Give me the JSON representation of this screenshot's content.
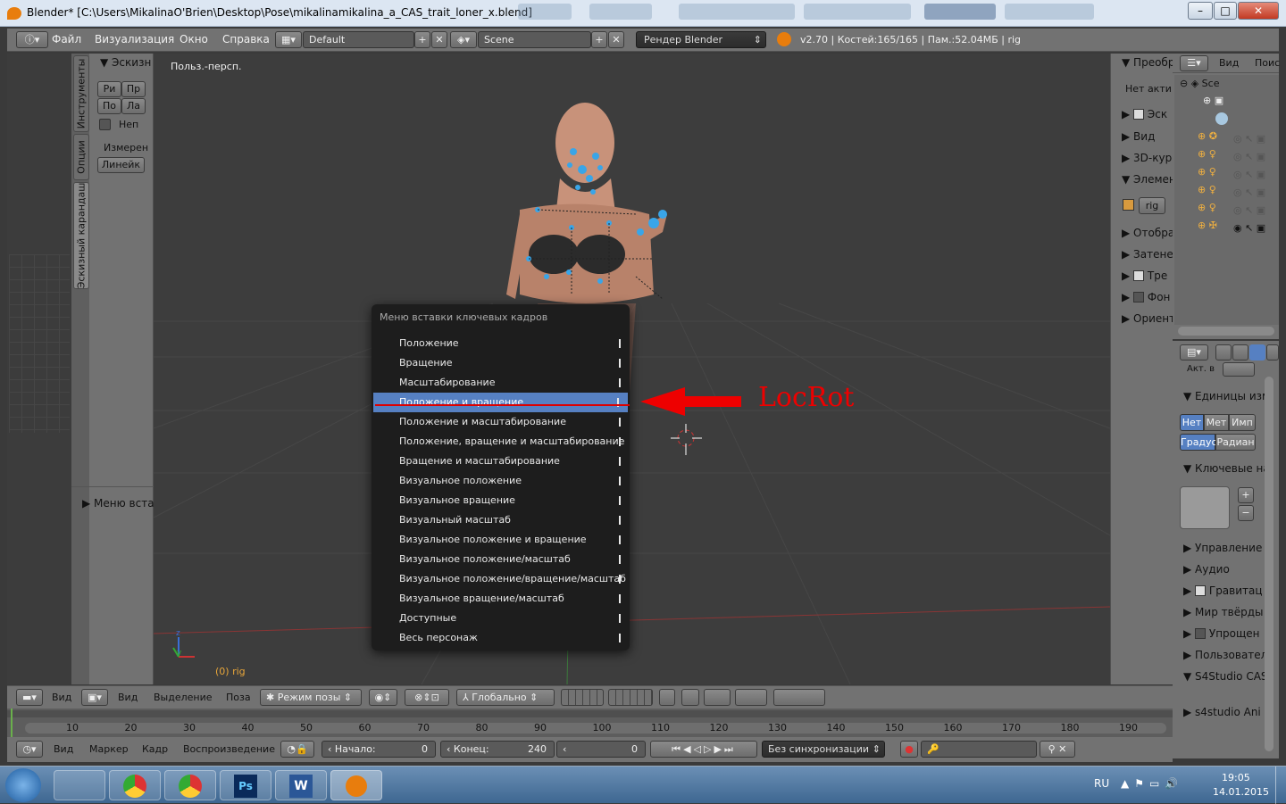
{
  "window": {
    "title": "Blender* [C:\\Users\\MikalinaO'Brien\\Desktop\\Pose\\mikalinamikalina_a_CAS_trait_loner_x.blend]",
    "min": "–",
    "max": "□",
    "close": "✕"
  },
  "header": {
    "menus": [
      "Файл",
      "Визуализация",
      "Окно",
      "Справка"
    ],
    "layout": "Default",
    "scene": "Scene",
    "engine": "Рендер Blender",
    "info": "v2.70 | Костей:165/165  | Пам.:52.04МБ | rig"
  },
  "left_tabs": [
    "Инструменты",
    "Опции",
    "Эскизный карандаш"
  ],
  "tool_panel": {
    "section": "Эскизн",
    "buttons": [
      "Ри",
      "Пр",
      "По",
      "Ла"
    ],
    "checkbox": "Неп",
    "measure_label": "Измерен",
    "ruler_button": "Линейк",
    "bottom": "Меню вста"
  },
  "viewport": {
    "label": "Польз.-персп.",
    "obj": "(0) rig",
    "annot": "LocRot"
  },
  "keyframe_menu": {
    "title": "Меню вставки ключевых кадров",
    "items": [
      "Положение",
      "Вращение",
      "Масштабирование",
      "Положение и вращение",
      "Положение и масштабирование",
      "Положение, вращение и масштабирование",
      "Вращение и масштабирование",
      "Визуальное положение",
      "Визуальное вращение",
      "Визуальный масштаб",
      "Визуальное положение и вращение",
      "Визуальное положение/масштаб",
      "Визуальное положение/вращение/масштаб",
      "Визуальное вращение/масштаб",
      "Доступные",
      "Весь персонаж"
    ],
    "selected": 3
  },
  "n_panel": {
    "items": [
      "Преобр",
      "Нет акти",
      "Эск",
      "Вид",
      "3D-кур",
      "Элемен",
      "rig",
      "Отобра",
      "Затене",
      "Тре",
      "Фон",
      "Ориент"
    ]
  },
  "outliner": {
    "view": "Вид",
    "search": "Поис",
    "scene": "Sce"
  },
  "props": {
    "act": "Акт. в",
    "units": "Единицы изм",
    "unit_btns": [
      "Нет",
      "Мет",
      "Имп"
    ],
    "rot_btns": [
      "Градус",
      "Радиан"
    ],
    "keying": "Ключевые на",
    "sections": [
      "Управление",
      "Аудио",
      "Гравитац",
      "Мир твёрды",
      "Упрощен",
      "Пользовател",
      "S4Studio CAS",
      "s4studio Ani"
    ]
  },
  "bottom_bar": {
    "view": "Вид",
    "view2": "Вид",
    "select": "Выделение",
    "pose": "Поза",
    "mode": "Режим позы",
    "orient": "Глобально"
  },
  "timeline": {
    "ticks": [
      "10",
      "20",
      "30",
      "40",
      "50",
      "60",
      "70",
      "80",
      "90",
      "100",
      "110",
      "120",
      "130",
      "140",
      "150",
      "160",
      "170",
      "180",
      "190"
    ]
  },
  "timeline_header": {
    "view": "Вид",
    "marker": "Маркер",
    "frame": "Кадр",
    "playback": "Воспроизведение",
    "start_label": "Начало:",
    "start": "0",
    "end_label": "Конец:",
    "end": "240",
    "current": "0",
    "sync": "Без синхронизации"
  },
  "taskbar": {
    "lang": "RU",
    "time": "19:05",
    "date": "14.01.2015"
  }
}
